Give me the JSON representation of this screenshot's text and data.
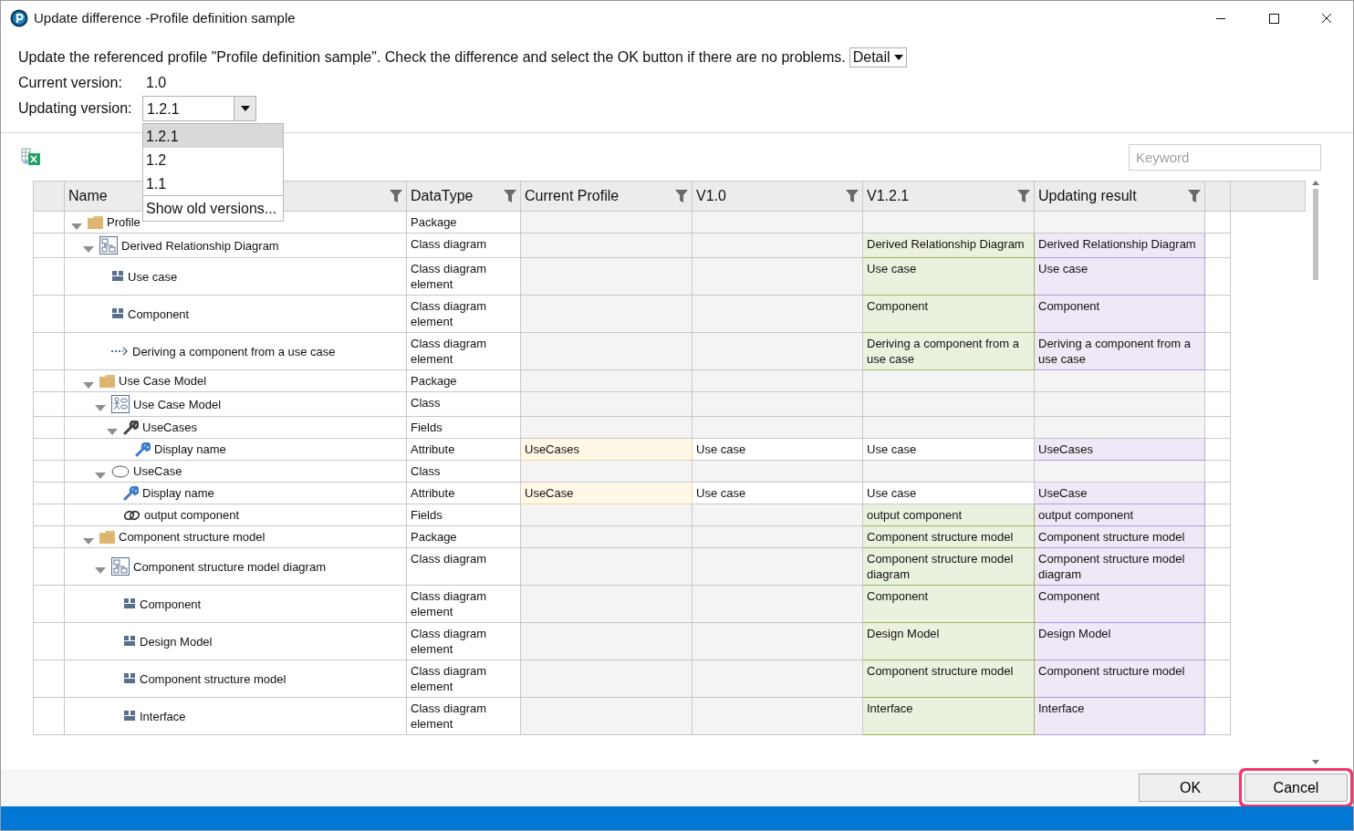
{
  "window": {
    "title": "Update difference -Profile definition sample"
  },
  "message": "Update the referenced profile \"Profile definition sample\". Check the difference and select the OK button if there are no problems.",
  "detail_select": {
    "value": "Detail"
  },
  "current_version": {
    "label": "Current version:",
    "value": "1.0"
  },
  "updating_version": {
    "label": "Updating version:",
    "value": "1.2.1",
    "dropdown": {
      "options": [
        {
          "label": "1.2.1",
          "selected": true
        },
        {
          "label": "1.2",
          "selected": false
        },
        {
          "label": "1.1",
          "selected": false
        }
      ],
      "footer": "Show old versions..."
    }
  },
  "keyword_field": {
    "placeholder": "Keyword"
  },
  "table": {
    "columns": [
      "Name",
      "DataType",
      "Current Profile",
      "V1.0",
      "V1.2.1",
      "Updating result"
    ],
    "rows": [
      {
        "name": "Profile",
        "kind": "folder",
        "datatype": "Package",
        "expanded": true,
        "children": [
          {
            "name": "Derived Relationship Diagram",
            "kind": "diagram",
            "datatype": "Class diagram",
            "expanded": true,
            "v1_2_1": {
              "text": "Derived Relationship Diagram",
              "kind": "new"
            },
            "result": {
              "text": "Derived Relationship Diagram",
              "kind": "result"
            },
            "children": [
              {
                "name": "Use case",
                "kind": "element",
                "datatype": "Class diagram element",
                "v1_2_1": {
                  "text": "Use case",
                  "kind": "new"
                },
                "result": {
                  "text": "Use case",
                  "kind": "result"
                }
              },
              {
                "name": "Component",
                "kind": "element",
                "datatype": "Class diagram element",
                "v1_2_1": {
                  "text": "Component",
                  "kind": "new"
                },
                "result": {
                  "text": "Component",
                  "kind": "result"
                }
              },
              {
                "name": "Deriving a component from a use case",
                "kind": "dependency",
                "datatype": "Class diagram element",
                "v1_2_1": {
                  "text": "Deriving a component from a use case",
                  "kind": "new"
                },
                "result": {
                  "text": "Deriving a component from a use case",
                  "kind": "result"
                }
              }
            ]
          },
          {
            "name": "Use Case Model",
            "kind": "folder",
            "datatype": "Package",
            "expanded": true,
            "children": [
              {
                "name": "Use Case Model",
                "kind": "usecase-model",
                "datatype": "Class",
                "expanded": true,
                "children": [
                  {
                    "name": "UseCases",
                    "kind": "wrench",
                    "datatype": "Fields",
                    "expanded": true,
                    "children": [
                      {
                        "name": "Display name",
                        "kind": "attribute",
                        "datatype": "Attribute",
                        "current": {
                          "text": "UseCases",
                          "kind": "differs"
                        },
                        "v1_0": {
                          "text": "Use case",
                          "kind": "plain"
                        },
                        "v1_2_1": {
                          "text": "Use case",
                          "kind": "plain"
                        },
                        "result": {
                          "text": "UseCases",
                          "kind": "result"
                        }
                      }
                    ]
                  }
                ]
              },
              {
                "name": "UseCase",
                "kind": "ellipse",
                "datatype": "Class",
                "expanded": true,
                "children": [
                  {
                    "name": "Display name",
                    "kind": "attribute",
                    "datatype": "Attribute",
                    "current": {
                      "text": "UseCase",
                      "kind": "differs"
                    },
                    "v1_0": {
                      "text": "Use case",
                      "kind": "plain"
                    },
                    "v1_2_1": {
                      "text": "Use case",
                      "kind": "plain"
                    },
                    "result": {
                      "text": "UseCase",
                      "kind": "result"
                    }
                  },
                  {
                    "name": "output component",
                    "kind": "link",
                    "datatype": "Fields",
                    "v1_2_1": {
                      "text": "output component",
                      "kind": "new"
                    },
                    "result": {
                      "text": "output component",
                      "kind": "result"
                    }
                  }
                ]
              }
            ]
          },
          {
            "name": "Component structure model",
            "kind": "folder",
            "datatype": "Package",
            "expanded": true,
            "v1_2_1": {
              "text": "Component structure model",
              "kind": "new"
            },
            "result": {
              "text": "Component structure model",
              "kind": "result"
            },
            "children": [
              {
                "name": "Component structure model diagram",
                "kind": "diagram",
                "datatype": "Class diagram",
                "expanded": true,
                "v1_2_1": {
                  "text": "Component structure model diagram",
                  "kind": "new"
                },
                "result": {
                  "text": "Component structure model diagram",
                  "kind": "result"
                },
                "children": [
                  {
                    "name": "Component",
                    "kind": "element",
                    "datatype": "Class diagram element",
                    "v1_2_1": {
                      "text": "Component",
                      "kind": "new"
                    },
                    "result": {
                      "text": "Component",
                      "kind": "result"
                    }
                  },
                  {
                    "name": "Design Model",
                    "kind": "element",
                    "datatype": "Class diagram element",
                    "v1_2_1": {
                      "text": "Design Model",
                      "kind": "new"
                    },
                    "result": {
                      "text": "Design Model",
                      "kind": "result"
                    }
                  },
                  {
                    "name": "Component structure model",
                    "kind": "element",
                    "datatype": "Class diagram element",
                    "v1_2_1": {
                      "text": "Component structure model",
                      "kind": "new"
                    },
                    "result": {
                      "text": "Component structure model",
                      "kind": "result"
                    }
                  },
                  {
                    "name": "Interface",
                    "kind": "element",
                    "datatype": "Class diagram element",
                    "v1_2_1": {
                      "text": "Interface",
                      "kind": "new"
                    },
                    "result": {
                      "text": "Interface",
                      "kind": "result"
                    }
                  }
                ]
              }
            ]
          }
        ]
      }
    ]
  },
  "buttons": [
    {
      "label": "OK",
      "focused": false
    },
    {
      "label": "Cancel",
      "focused": true
    }
  ]
}
